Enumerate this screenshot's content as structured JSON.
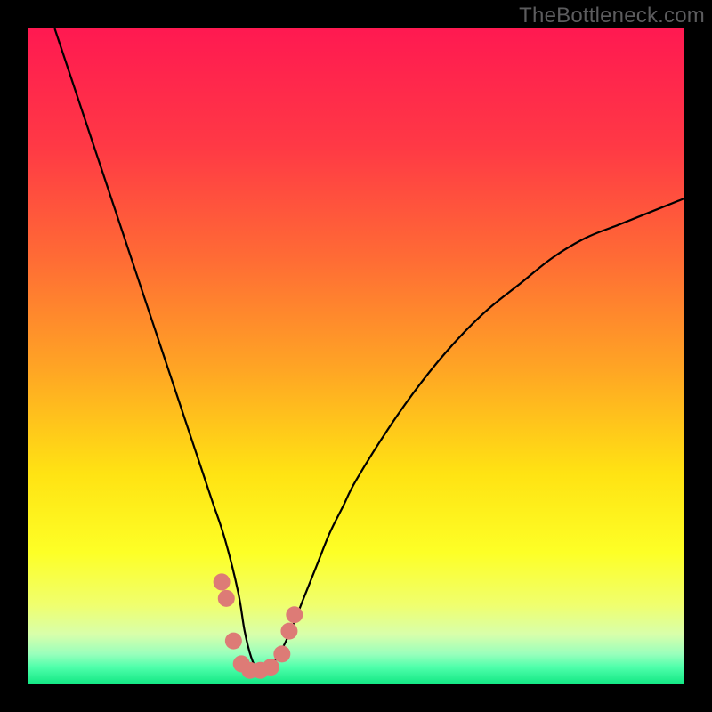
{
  "watermark": "TheBottleneck.com",
  "chart_data": {
    "type": "line",
    "title": "",
    "xlabel": "",
    "ylabel": "",
    "xlim": [
      0,
      100
    ],
    "ylim": [
      0,
      100
    ],
    "grid": false,
    "series": [
      {
        "name": "bottleneck-curve",
        "x": [
          4,
          6,
          8,
          10,
          12,
          14,
          16,
          18,
          20,
          22,
          24,
          26,
          28,
          30,
          32,
          33,
          34,
          35,
          36,
          38,
          40,
          42,
          44,
          46,
          48,
          50,
          55,
          60,
          65,
          70,
          75,
          80,
          85,
          90,
          95,
          100
        ],
        "y": [
          100,
          94,
          88,
          82,
          76,
          70,
          64,
          58,
          52,
          46,
          40,
          34,
          28,
          22,
          14,
          8,
          4,
          2,
          2,
          4,
          8,
          13,
          18,
          23,
          27,
          31,
          39,
          46,
          52,
          57,
          61,
          65,
          68,
          70,
          72,
          74
        ]
      }
    ],
    "markers": {
      "name": "highlight-points",
      "color": "#dd7b76",
      "points": [
        {
          "x": 29.5,
          "y": 15.5
        },
        {
          "x": 30.2,
          "y": 13.0
        },
        {
          "x": 31.3,
          "y": 6.5
        },
        {
          "x": 32.5,
          "y": 3.0
        },
        {
          "x": 33.8,
          "y": 2.0
        },
        {
          "x": 35.4,
          "y": 2.0
        },
        {
          "x": 37.0,
          "y": 2.5
        },
        {
          "x": 38.7,
          "y": 4.5
        },
        {
          "x": 39.8,
          "y": 8.0
        },
        {
          "x": 40.6,
          "y": 10.5
        }
      ]
    },
    "background_gradient": {
      "stops": [
        {
          "offset": 0.0,
          "color": "#ff1951"
        },
        {
          "offset": 0.18,
          "color": "#ff3945"
        },
        {
          "offset": 0.35,
          "color": "#ff6b35"
        },
        {
          "offset": 0.52,
          "color": "#ffa524"
        },
        {
          "offset": 0.68,
          "color": "#ffe313"
        },
        {
          "offset": 0.8,
          "color": "#fdff26"
        },
        {
          "offset": 0.88,
          "color": "#f0ff6e"
        },
        {
          "offset": 0.925,
          "color": "#d8ffab"
        },
        {
          "offset": 0.955,
          "color": "#99ffbc"
        },
        {
          "offset": 0.975,
          "color": "#4fffab"
        },
        {
          "offset": 1.0,
          "color": "#14e885"
        }
      ]
    }
  }
}
